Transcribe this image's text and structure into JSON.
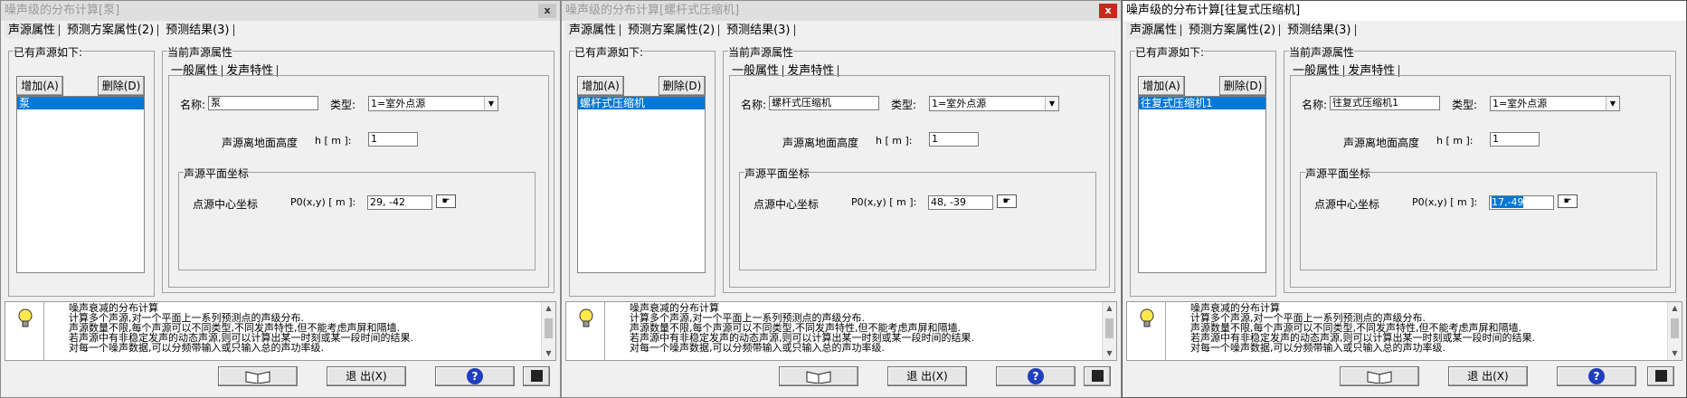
{
  "windows": [
    {
      "title": "噪声级的分布计算[泵]",
      "state": "inactive",
      "tabs": [
        "声源属性",
        "预测方案属性(2)",
        "预测结果(3)"
      ],
      "sources_group": "已有声源如下:",
      "add_button": "增加(A)",
      "delete_button": "删除(D)",
      "sources": [
        "泵"
      ],
      "current_group": "当前声源属性",
      "subtabs": [
        "一般属性",
        "发声特性"
      ],
      "name_label": "名称:",
      "name_value": "泵",
      "type_label": "类型:",
      "type_value": "1=室外点源",
      "height_label": "声源离地面高度",
      "height_unit": "h [ m ]:",
      "height_value": "1",
      "coord_group": "声源平面坐标",
      "coord_label": "点源中心坐标",
      "coord_unit": "P0(x,y) [ m ]:",
      "coord_value": "29, -42",
      "exit_button": "退 出(X)",
      "close_icon": "x"
    },
    {
      "title": "噪声级的分布计算[螺杆式压缩机]",
      "state": "inactive",
      "tabs": [
        "声源属性",
        "预测方案属性(2)",
        "预测结果(3)"
      ],
      "sources_group": "已有声源如下:",
      "add_button": "增加(A)",
      "delete_button": "删除(D)",
      "sources": [
        "螺杆式压缩机"
      ],
      "current_group": "当前声源属性",
      "subtabs": [
        "一般属性",
        "发声特性"
      ],
      "name_label": "名称:",
      "name_value": "螺杆式压缩机",
      "type_label": "类型:",
      "type_value": "1=室外点源",
      "height_label": "声源离地面高度",
      "height_unit": "h [ m ]:",
      "height_value": "1",
      "coord_group": "声源平面坐标",
      "coord_label": "点源中心坐标",
      "coord_unit": "P0(x,y) [ m ]:",
      "coord_value": "48, -39",
      "exit_button": "退 出(X)",
      "close_icon": "x"
    },
    {
      "title": "噪声级的分布计算[往复式压缩机]",
      "state": "active",
      "tabs": [
        "声源属性",
        "预测方案属性(2)",
        "预测结果(3)"
      ],
      "sources_group": "已有声源如下:",
      "add_button": "增加(A)",
      "delete_button": "删除(D)",
      "sources": [
        "往复式压缩机1"
      ],
      "current_group": "当前声源属性",
      "subtabs": [
        "一般属性",
        "发声特性"
      ],
      "name_label": "名称:",
      "name_value": "往复式压缩机1",
      "type_label": "类型:",
      "type_value": "1=室外点源",
      "height_label": "声源离地面高度",
      "height_unit": "h [ m ]:",
      "height_value": "1",
      "coord_group": "声源平面坐标",
      "coord_label": "点源中心坐标",
      "coord_unit": "P0(x,y) [ m ]:",
      "coord_value": "17,-49",
      "exit_button": "退 出(X)",
      "close_icon": "x"
    }
  ],
  "info_lines": [
    "噪声衰减的分布计算",
    "计算多个声源,对一个平面上一系列预测点的声级分布.",
    "声源数量不限,每个声源可以不同类型,不同发声特性,但不能考虑声屏和隔墙.",
    "若声源中有非稳定发声的动态声源,则可以计算出某一时刻或某一段时间的结果.",
    "对每一个噪声数据,可以分频带输入或只输入总的声功率级."
  ],
  "icons": [
    "lightbulb-icon",
    "book-icon",
    "help-icon",
    "save-icon",
    "pointer-hand-icon"
  ],
  "colors": {
    "selection": "#0078d7",
    "active_close": "#c42b1c"
  }
}
